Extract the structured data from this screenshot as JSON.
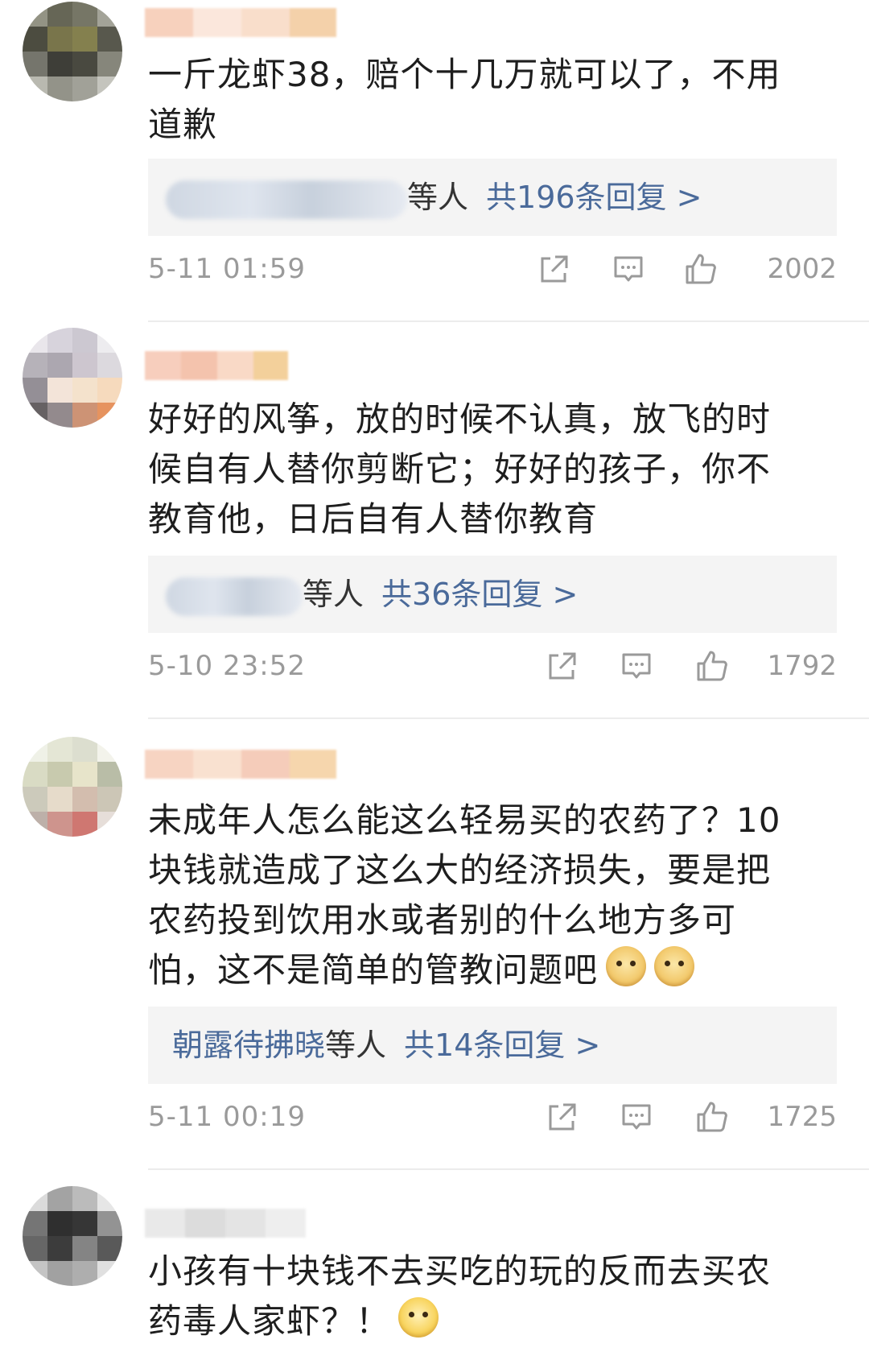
{
  "comments": [
    {
      "text": "一斤龙虾38，赔个十几万就可以了，不用道歉",
      "replies_prefix": "",
      "replies_who": "等人",
      "replies_count": "共196条回复 >",
      "time": "5-11 01:59",
      "likes": "2002"
    },
    {
      "text": "好好的风筝，放的时候不认真，放飞的时候自有人替你剪断它；好好的孩子，你不教育他，日后自有人替你教育",
      "replies_prefix": "",
      "replies_who": "等人",
      "replies_count": "共36条回复 >",
      "time": "5-10 23:52",
      "likes": "1792"
    },
    {
      "text": "未成年人怎么能这么轻易买的农药了？10块钱就造成了这么大的经济损失，要是把农药投到饮用水或者别的什么地方多可怕，这不是简单的管教问题吧",
      "replies_prefix": "朝露待拂晓",
      "replies_who": "等人",
      "replies_count": "共14条回复 >",
      "time": "5-11 00:19",
      "likes": "1725"
    },
    {
      "text": "小孩有十块钱不去买吃的玩的反而去买农药毒人家虾？！"
    }
  ],
  "icons": [
    "share-icon",
    "comment-icon",
    "thumbs-up-icon",
    "doge-emoji",
    "shush-emoji"
  ],
  "colors": {
    "link": "#4a6a9a",
    "meta": "#9a9a9a",
    "reply_bg": "#f4f4f4"
  }
}
